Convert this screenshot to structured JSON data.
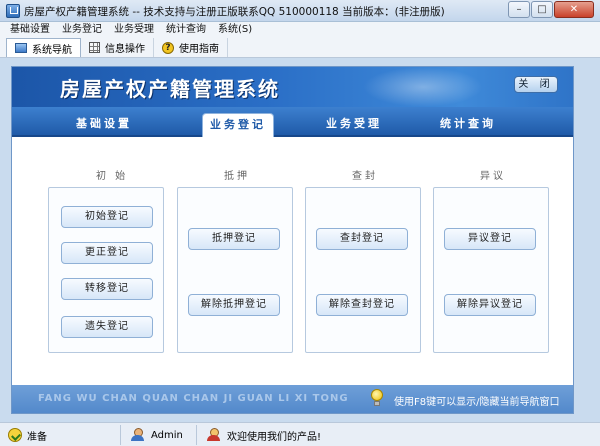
{
  "window": {
    "title": "房屋产权产籍管理系统  -- 技术支持与注册正版联系QQ 510000118    当前版本：(非注册版)",
    "controls": [
      "minimize",
      "maximize",
      "close"
    ]
  },
  "menu": [
    {
      "label": "基础设置"
    },
    {
      "label": "业务登记"
    },
    {
      "label": "业务受理"
    },
    {
      "label": "统计查询"
    },
    {
      "label": "系统(S)"
    }
  ],
  "toolbar": [
    {
      "label": "系统导航",
      "icon": "monitor-icon",
      "active": true
    },
    {
      "label": "信息操作",
      "icon": "grid-icon",
      "active": false
    },
    {
      "label": "使用指南",
      "icon": "help-icon",
      "active": false
    }
  ],
  "banner": {
    "title": "房屋产权产籍管理系统",
    "close_label": "关 闭"
  },
  "tabs": [
    {
      "label": "基础设置",
      "active": false
    },
    {
      "label": "业务登记",
      "active": true
    },
    {
      "label": "业务受理",
      "active": false
    },
    {
      "label": "统计查询",
      "active": false
    }
  ],
  "groups": [
    {
      "title": "初 始",
      "buttons": [
        "初始登记",
        "更正登记",
        "转移登记",
        "遗失登记"
      ]
    },
    {
      "title": "抵押",
      "buttons": [
        "抵押登记",
        "解除抵押登记"
      ]
    },
    {
      "title": "查封",
      "buttons": [
        "查封登记",
        "解除查封登记"
      ]
    },
    {
      "title": "异议",
      "buttons": [
        "异议登记",
        "解除异议登记"
      ]
    }
  ],
  "footer": {
    "pinyin": "FANG WU CHAN QUAN CHAN JI GUAN LI XI TONG",
    "hint": "使用F8键可以显示/隐藏当前导航窗口"
  },
  "status": {
    "ready": "准备",
    "user": "Admin",
    "welcome": "欢迎使用我们的产品!"
  },
  "colors": {
    "banner": "#2a6ec6",
    "tabstrip": "#1f5aa8",
    "footer": "#5f93d0",
    "window_bg": "#c9dbee"
  }
}
